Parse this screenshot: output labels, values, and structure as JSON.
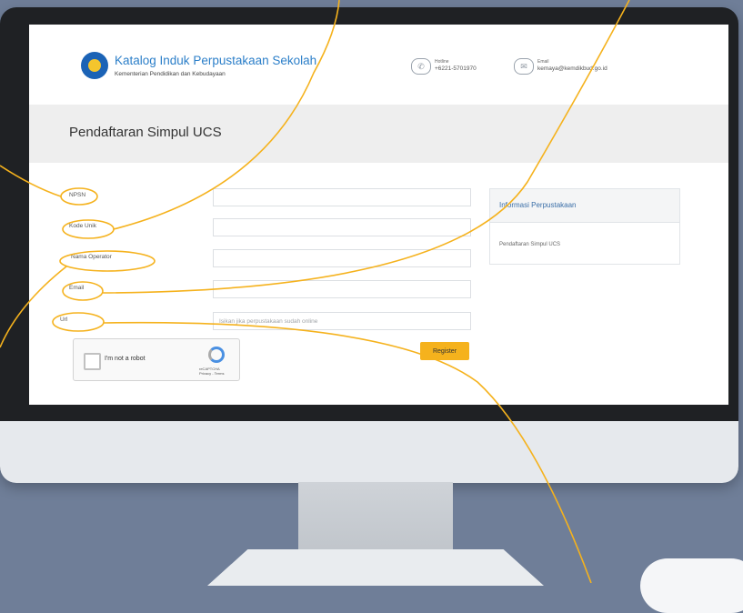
{
  "header": {
    "site_title": "Katalog Induk Perpustakaan Sekolah",
    "site_subtitle": "Kementerian Pendidikan dan Kebudayaan",
    "hotline_label": "Hotline",
    "hotline_value": "+6221-5701970",
    "email_label": "Email",
    "email_value": "kemaya@kemdikbud.go.id"
  },
  "page": {
    "title": "Pendaftaran Simpul UCS"
  },
  "form": {
    "fields": [
      {
        "label": "NPSN",
        "placeholder": ""
      },
      {
        "label": "Kode Unik",
        "placeholder": ""
      },
      {
        "label": "Nama Operator",
        "placeholder": ""
      },
      {
        "label": "Email",
        "placeholder": ""
      },
      {
        "label": "Url",
        "placeholder": "Isikan jika perpustakaan sudah online"
      }
    ],
    "register_label": "Register",
    "captcha_label": "I'm not a robot",
    "captcha_brand": "reCAPTCHA\nPrivacy - Terms"
  },
  "sidebar": {
    "title": "Informasi Perpustakaan",
    "items": [
      "Pendaftaran Simpul UCS"
    ]
  },
  "icons": {
    "hotline": "phone-icon",
    "email": "mail-icon",
    "logo": "tut-wuri-handayani-logo",
    "captcha": "recaptcha-icon"
  },
  "colors": {
    "background": "#6f7e98",
    "callout": "#f5b21d",
    "register_button": "#f5b21d",
    "title_text": "#2c7fc9"
  }
}
